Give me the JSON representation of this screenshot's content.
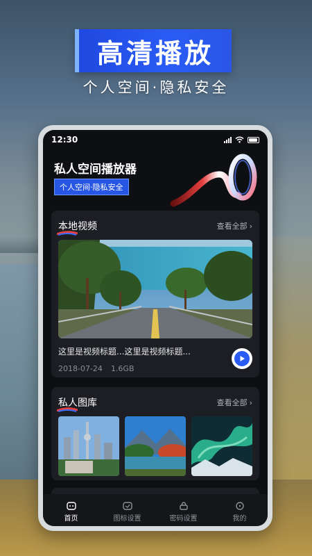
{
  "promo": {
    "headline": "高清播放",
    "subline": "个人空间·隐私安全"
  },
  "status_bar": {
    "time": "12:30",
    "icons": [
      "signal-icon",
      "wifi-icon",
      "battery-icon"
    ]
  },
  "app": {
    "title": "私人空间播放器",
    "tagline": "个人空间·隐私安全"
  },
  "local_video": {
    "section_title": "本地视频",
    "view_all": "查看全部",
    "video_title": "这里是视频标题...这里是视频标题...",
    "date": "2018-07-24",
    "size": "1.6GB"
  },
  "private_gallery": {
    "section_title": "私人图库",
    "view_all": "查看全部",
    "images": [
      "city-skyline-image",
      "lake-mountains-image",
      "aurora-image"
    ]
  },
  "carousel": {
    "dot_count": 5,
    "active_index": 3
  },
  "tabs": [
    {
      "label": "首页",
      "icon": "home-icon",
      "active": true
    },
    {
      "label": "图标设置",
      "icon": "icon-settings-icon",
      "active": false
    },
    {
      "label": "密码设置",
      "icon": "password-icon",
      "active": false
    },
    {
      "label": "我的",
      "icon": "profile-icon",
      "active": false
    }
  ],
  "colors": {
    "accent": "#2a5cf5",
    "screen_bg": "#0e0f13",
    "card_bg": "#1d1e23"
  }
}
